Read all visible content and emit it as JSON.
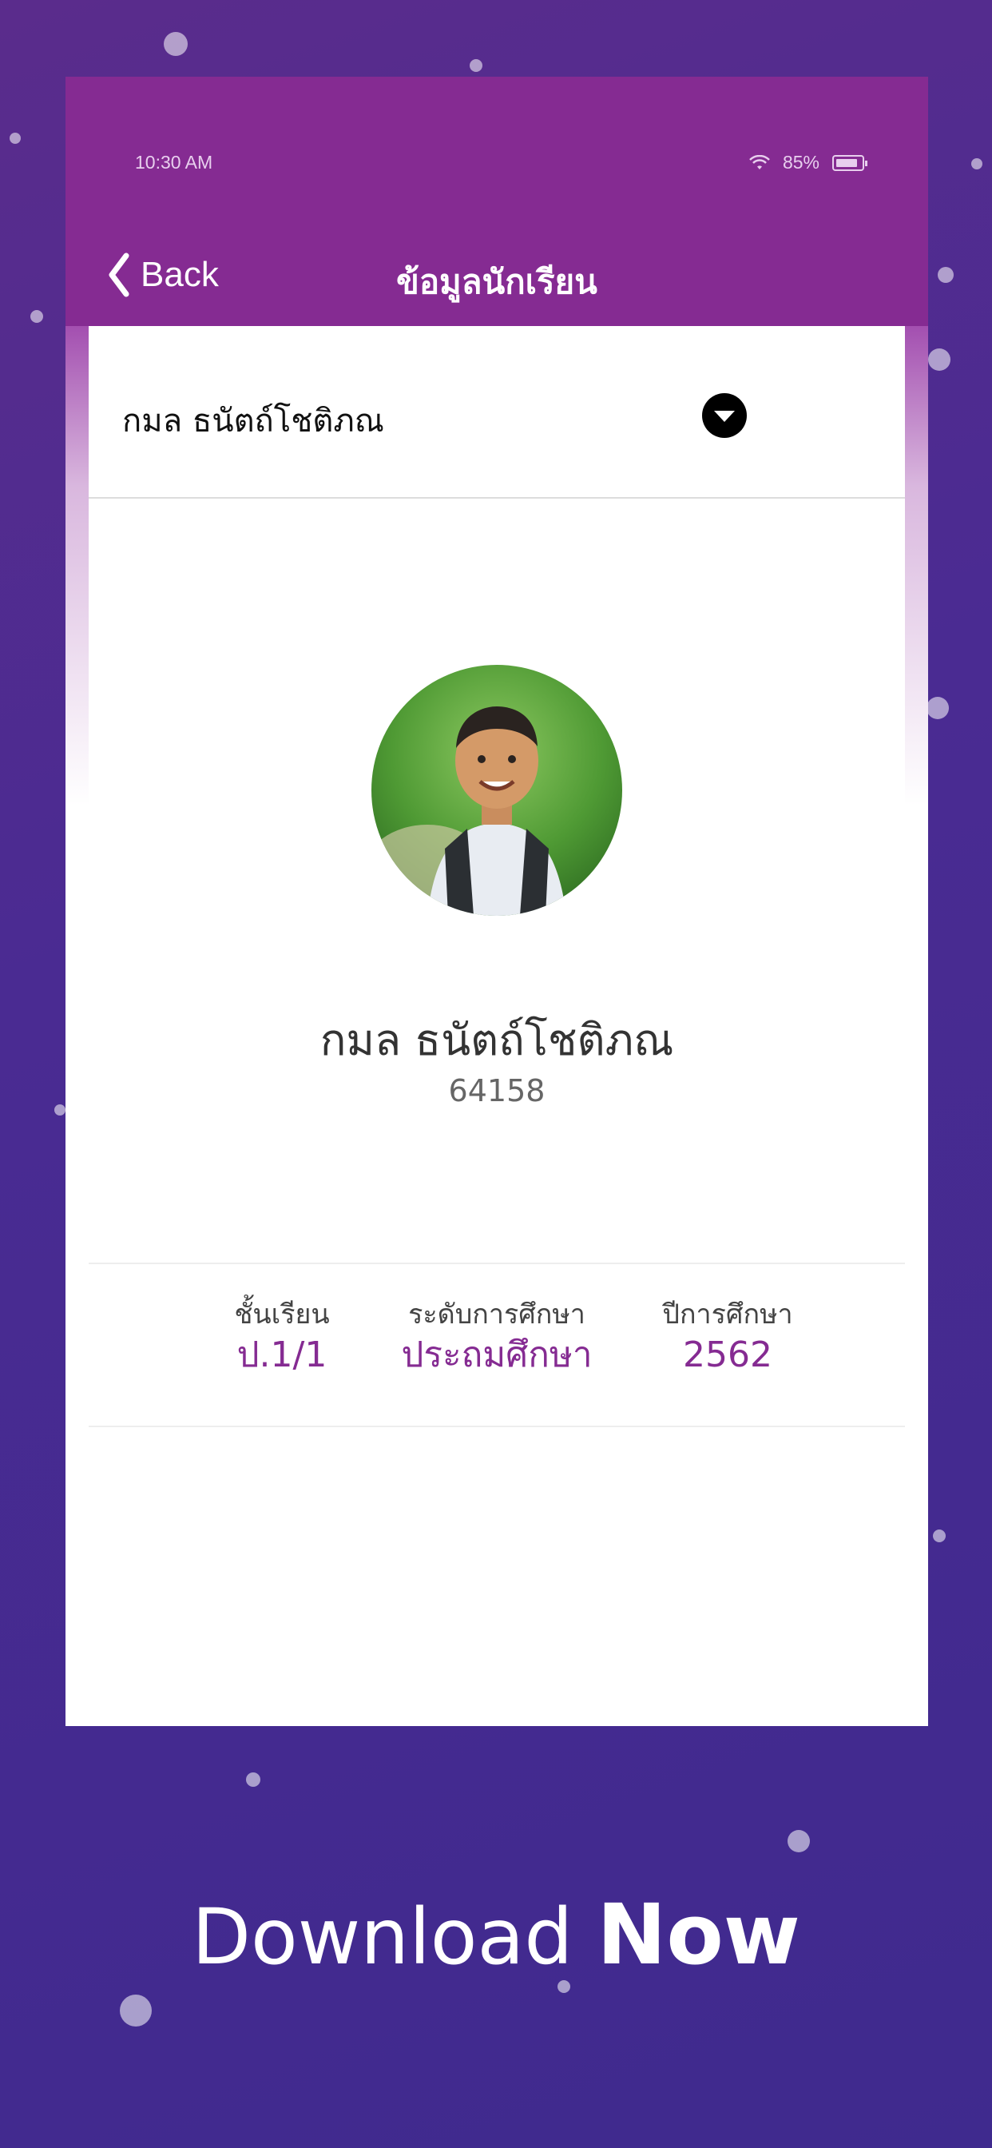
{
  "status_bar": {
    "time": "10:30 AM",
    "battery_pct": "85%"
  },
  "navbar": {
    "back_label": "Back",
    "title": "ข้อมูลนักเรียน"
  },
  "selector": {
    "selected_student": "กมล ธนัตถ์โชติภณ"
  },
  "profile": {
    "name": "กมล ธนัตถ์โชติภณ",
    "student_id": "64158"
  },
  "info": [
    {
      "label": "ชั้นเรียน",
      "value": "ป.1/1"
    },
    {
      "label": "ระดับการศึกษา",
      "value": "ประถมศึกษา"
    },
    {
      "label": "ปีการศึกษา",
      "value": "2562"
    }
  ],
  "promo": {
    "word1": "Download",
    "word2": "Now"
  },
  "colors": {
    "accent": "#852b92",
    "background": "#4a2b92"
  }
}
